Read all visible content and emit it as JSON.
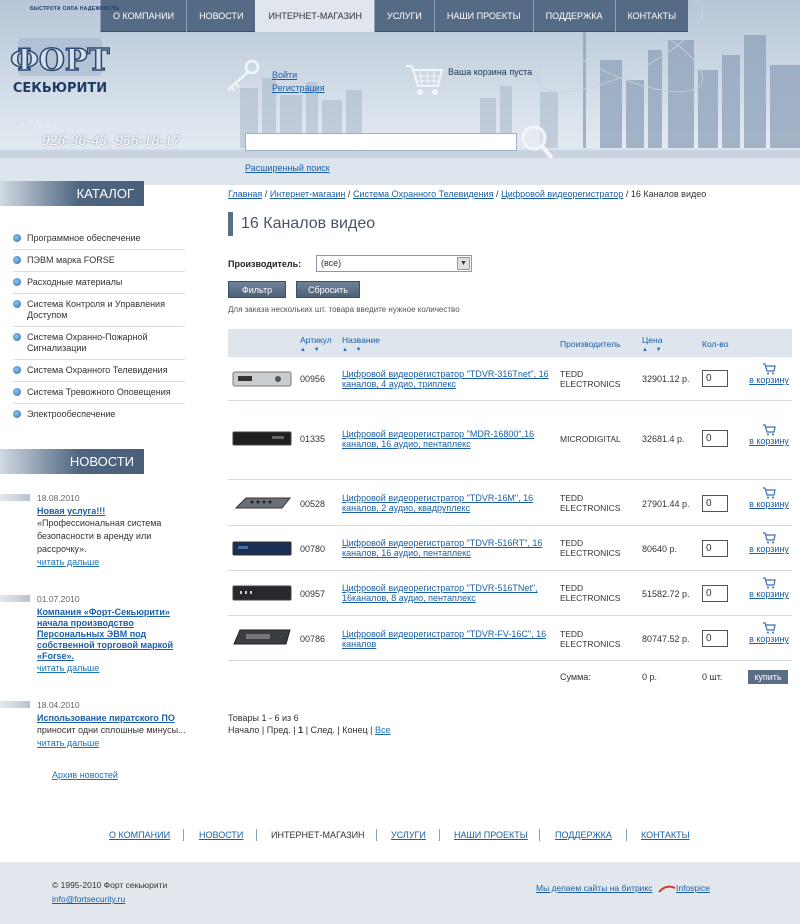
{
  "topnav": [
    "О КОМПАНИИ",
    "НОВОСТИ",
    "ИНТЕРНЕТ-МАГАЗИН",
    "УСЛУГИ",
    "НАШИ ПРОЕКТЫ",
    "ПОДДЕРЖКА",
    "КОНТАКТЫ"
  ],
  "logo": {
    "slogan": "БЫСТРОТА СИЛА НАДЕЖНОСТЬ",
    "line1": "ФОРТ",
    "line2": "СЕКЬЮРИТИ"
  },
  "phone": {
    "prefix": "+7 (495)",
    "numbers": "926-36-43, 956-18-17"
  },
  "auth": {
    "login": "Войти",
    "register": "Регистрация"
  },
  "cart": {
    "status": "Ваша корзина пуста"
  },
  "search": {
    "placeholder": "",
    "advanced": "Расширенный поиск"
  },
  "sidebar": {
    "catalog_title": "КАТАЛОГ",
    "catalog": [
      "Программное обеспечение",
      "ПЭВМ марка FORSE",
      "Расходные материалы",
      "Система Контроля и Управления Доступом",
      "Система Охранно-Пожарной Сигнализации",
      "Система Охранного Телевидения",
      "Система Тревожного Оповещения",
      "Электрообеспечение"
    ],
    "news_title": "НОВОСТИ",
    "news": [
      {
        "date": "18.08.2010",
        "title": "Новая услуга!!!",
        "text": "«Профессиональная система безопасности в аренду или рассрочку».",
        "more": "читать дальше"
      },
      {
        "date": "01.07.2010",
        "title": "Компания «Форт-Секьюрити» начала производство Персональных ЭВМ под собственной торговой маркой «Forse».",
        "text": "",
        "more": "читать дальше"
      },
      {
        "date": "18.04.2010",
        "title": "Использование пиратского ПО",
        "text": "приносит одни сплошные минусы...",
        "more": "читать дальше"
      }
    ],
    "archive": "Архив новостей"
  },
  "breadcrumb": [
    "Главная",
    "Интернет-магазин",
    "Системa Охранного Телевидения",
    "Цифровой видеорегистратор"
  ],
  "breadcrumb_current": "16 Каналов видео",
  "breadcrumb_sep": "/",
  "page_title": "16 Каналов видео",
  "filter": {
    "label": "Производитель:",
    "value": "(все)",
    "arrow": "▼",
    "apply": "Фильтр",
    "reset": "Сбросить"
  },
  "note": "Для заказа нескольких шт. товара введите нужное количество",
  "table": {
    "headers": {
      "art": "Артикул",
      "name": "Название",
      "mfr": "Производитель",
      "price": "Цена",
      "qty": "Кол-во"
    },
    "sort_arrows": "▲ ▼",
    "cart_link": "в корзину",
    "rows": [
      {
        "art": "00956",
        "name": "Цифровой видеорегистратор \"TDVR-316Tnet\", 16 каналов, 4 аудио, триплекс",
        "mfr": "TEDD ELECTRONICS",
        "price": "32901.12 р.",
        "qty": "0"
      },
      {
        "art": "01335",
        "name": "Цифровой видеорегистратор \"MDR-16800\",16 каналов, 16 аудио, пентаплекс",
        "mfr": "MICRODIGITAL",
        "price": "32681.4 р.",
        "qty": "0"
      },
      {
        "art": "00528",
        "name": "Цифровой видеорегистратор \"TDVR-16M\", 16 каналов, 2 аудио, квадруплекс",
        "mfr": "TEDD ELECTRONICS",
        "price": "27901.44 р.",
        "qty": "0"
      },
      {
        "art": "00780",
        "name": "Цифровой видеорегистратор \"TDVR-516RT\", 16 каналов, 16 аудио, пентаплекс",
        "mfr": "TEDD ELECTRONICS",
        "price": "80640 р.",
        "qty": "0"
      },
      {
        "art": "00957",
        "name": "Цифровой видеорегистратор \"TDVR-516TNet\", 16каналов, 8 аудио, пентаплекс",
        "mfr": "TEDD ELECTRONICS",
        "price": "51582.72 р.",
        "qty": "0"
      },
      {
        "art": "00786",
        "name": "Цифровой видеорегистратор \"TDVR-FV-16C\", 16 каналов",
        "mfr": "TEDD ELECTRONICS",
        "price": "80747.52 р.",
        "qty": "0"
      }
    ],
    "sum_label": "Сумма:",
    "sum_price": "0 р.",
    "sum_qty": "0 шт.",
    "buy": "купить"
  },
  "pagination": {
    "summary": "Товары 1 - 6 из 6",
    "first": "Начало",
    "prev": "Пред.",
    "current": "1",
    "next": "След.",
    "last": "Конец",
    "all": "Все",
    "sep": "|"
  },
  "footer_nav": [
    "О КОМПАНИИ",
    "НОВОСТИ",
    "ИНТЕРНЕТ-МАГАЗИН",
    "УСЛУГИ",
    "НАШИ ПРОЕКТЫ",
    "ПОДДЕРЖКА",
    "КОНТАКТЫ"
  ],
  "footer": {
    "copyright": "© 1995-2010 Форт секьюрити",
    "email": "info@fortsecurity.ru",
    "bitrix": "Мы делаем сайты на битрикс",
    "infospice": "Infospice"
  }
}
